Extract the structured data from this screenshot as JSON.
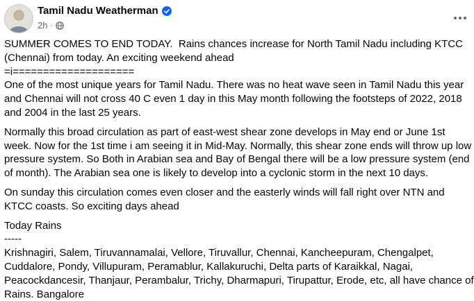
{
  "post": {
    "author": "Tamil Nadu Weatherman",
    "time": "2h",
    "separator": "·",
    "colors": {
      "verified": "#0866ff",
      "meta": "#65676b",
      "text": "#050505"
    },
    "icons": {
      "verified": "verified-badge-icon",
      "audience": "globe-icon",
      "menu": "more-options-icon"
    },
    "paragraphs": [
      "SUMMER COMES TO END TODAY.  Rains chances increase for North Tamil Nadu including KTCC (Chennai) from today. An exciting weekend ahead",
      "=i====================",
      "One of the most unique years for Tamil Nadu. There was no heat wave seen in Tamil Nadu this year and Chennai will not cross 40 C even 1 day in this May month following the footsteps of 2022, 2018 and 2004 in the last 25 years.",
      "Normally this broad circulation as part of east-west shear zone develops in May end or June 1st week. Now for the 1st time i am seeing it in Mid-May. Normally, this shear zone ends will throw up low pressure system. So Both in Arabian sea and Bay of Bengal there will be a low pressure system (end of month). The Arabian sea one is likely to develop into a cyclonic storm in the next 10 days.",
      "On sunday this circulation comes even closer and the easterly winds will fall right over NTN and KTCC coasts. So exciting days ahead",
      "Today Rains",
      "-----",
      "Krishnagiri, Salem, Tiruvannamalai, Vellore, Tiruvallur, Chennai, Kancheepuram, Chengalpet, Cuddalore, Pondy, Villupuram, Peramablur, Kallakuruchi, Delta parts of Karaikkal, Nagai, Peacockdancesir, Thanjaur, Perambalur, Trichy, Dharmapuri, Tirupattur, Erode, etc, all have chance of Rains. Bangalore"
    ]
  }
}
